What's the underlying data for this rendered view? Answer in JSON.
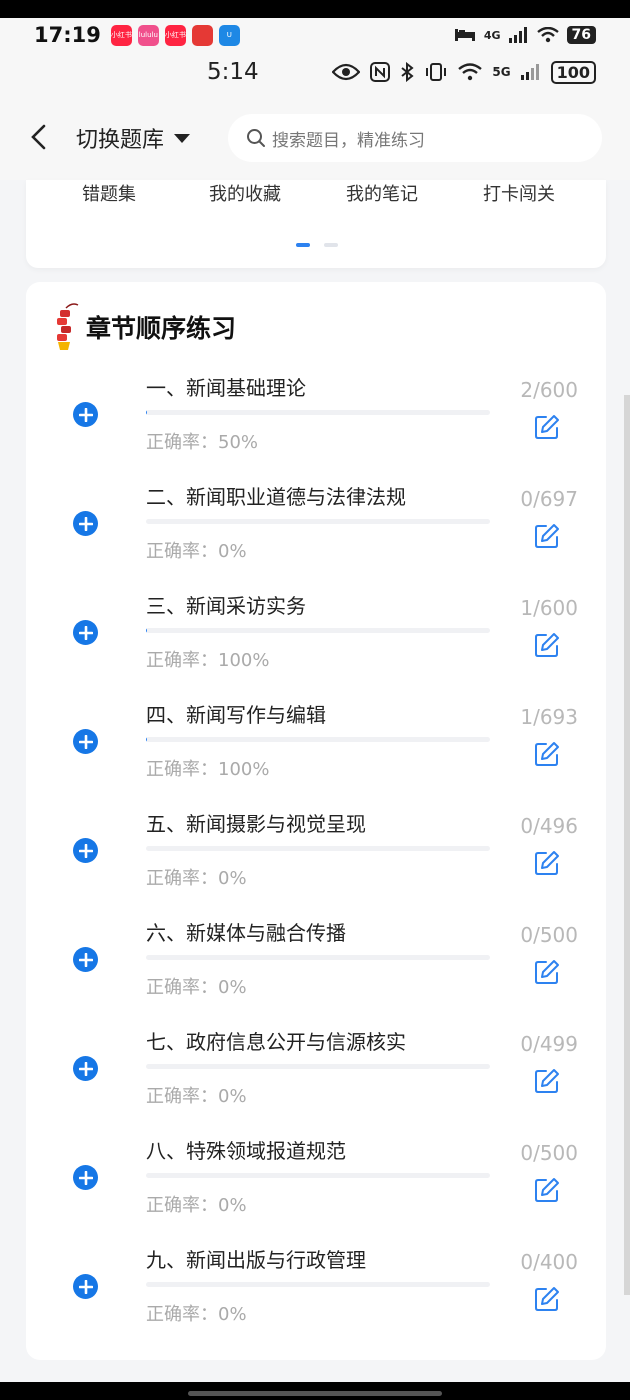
{
  "status_bar_1": {
    "time": "17:19",
    "network": "4G",
    "battery": "76",
    "app_icons": [
      {
        "label": "小红书",
        "color": "#ff2442"
      },
      {
        "label": "lululu",
        "color": "#f0508c"
      },
      {
        "label": "小红书",
        "color": "#ff2442"
      },
      {
        "label": "",
        "color": "#e53935"
      },
      {
        "label": "U",
        "color": "#1e88e5"
      }
    ]
  },
  "status_bar_2": {
    "time": "5:14",
    "network": "5G",
    "battery": "100"
  },
  "header": {
    "bank_switch_label": "切换题库",
    "search_placeholder": "搜索题目，精准练习"
  },
  "quick_tabs": [
    "错题集",
    "我的收藏",
    "我的笔记",
    "打卡闯关"
  ],
  "section": {
    "title": "章节顺序练习",
    "accuracy_label": "正确率：",
    "chapters": [
      {
        "title": "一、新闻基础理论",
        "done": 2,
        "total": 600,
        "count": "2/600",
        "accuracy": "50%"
      },
      {
        "title": "二、新闻职业道德与法律法规",
        "done": 0,
        "total": 697,
        "count": "0/697",
        "accuracy": "0%"
      },
      {
        "title": "三、新闻采访实务",
        "done": 1,
        "total": 600,
        "count": "1/600",
        "accuracy": "100%"
      },
      {
        "title": "四、新闻写作与编辑",
        "done": 1,
        "total": 693,
        "count": "1/693",
        "accuracy": "100%"
      },
      {
        "title": "五、新闻摄影与视觉呈现",
        "done": 0,
        "total": 496,
        "count": "0/496",
        "accuracy": "0%"
      },
      {
        "title": "六、新媒体与融合传播",
        "done": 0,
        "total": 500,
        "count": "0/500",
        "accuracy": "0%"
      },
      {
        "title": "七、政府信息公开与信源核实",
        "done": 0,
        "total": 499,
        "count": "0/499",
        "accuracy": "0%"
      },
      {
        "title": "八、特殊领域报道规范",
        "done": 0,
        "total": 500,
        "count": "0/500",
        "accuracy": "0%"
      },
      {
        "title": "九、新闻出版与行政管理",
        "done": 0,
        "total": 400,
        "count": "0/400",
        "accuracy": "0%"
      }
    ]
  },
  "colors": {
    "accent": "#1677e6",
    "count_gray": "#b8b8b8",
    "edit_icon": "#2d82f0"
  }
}
